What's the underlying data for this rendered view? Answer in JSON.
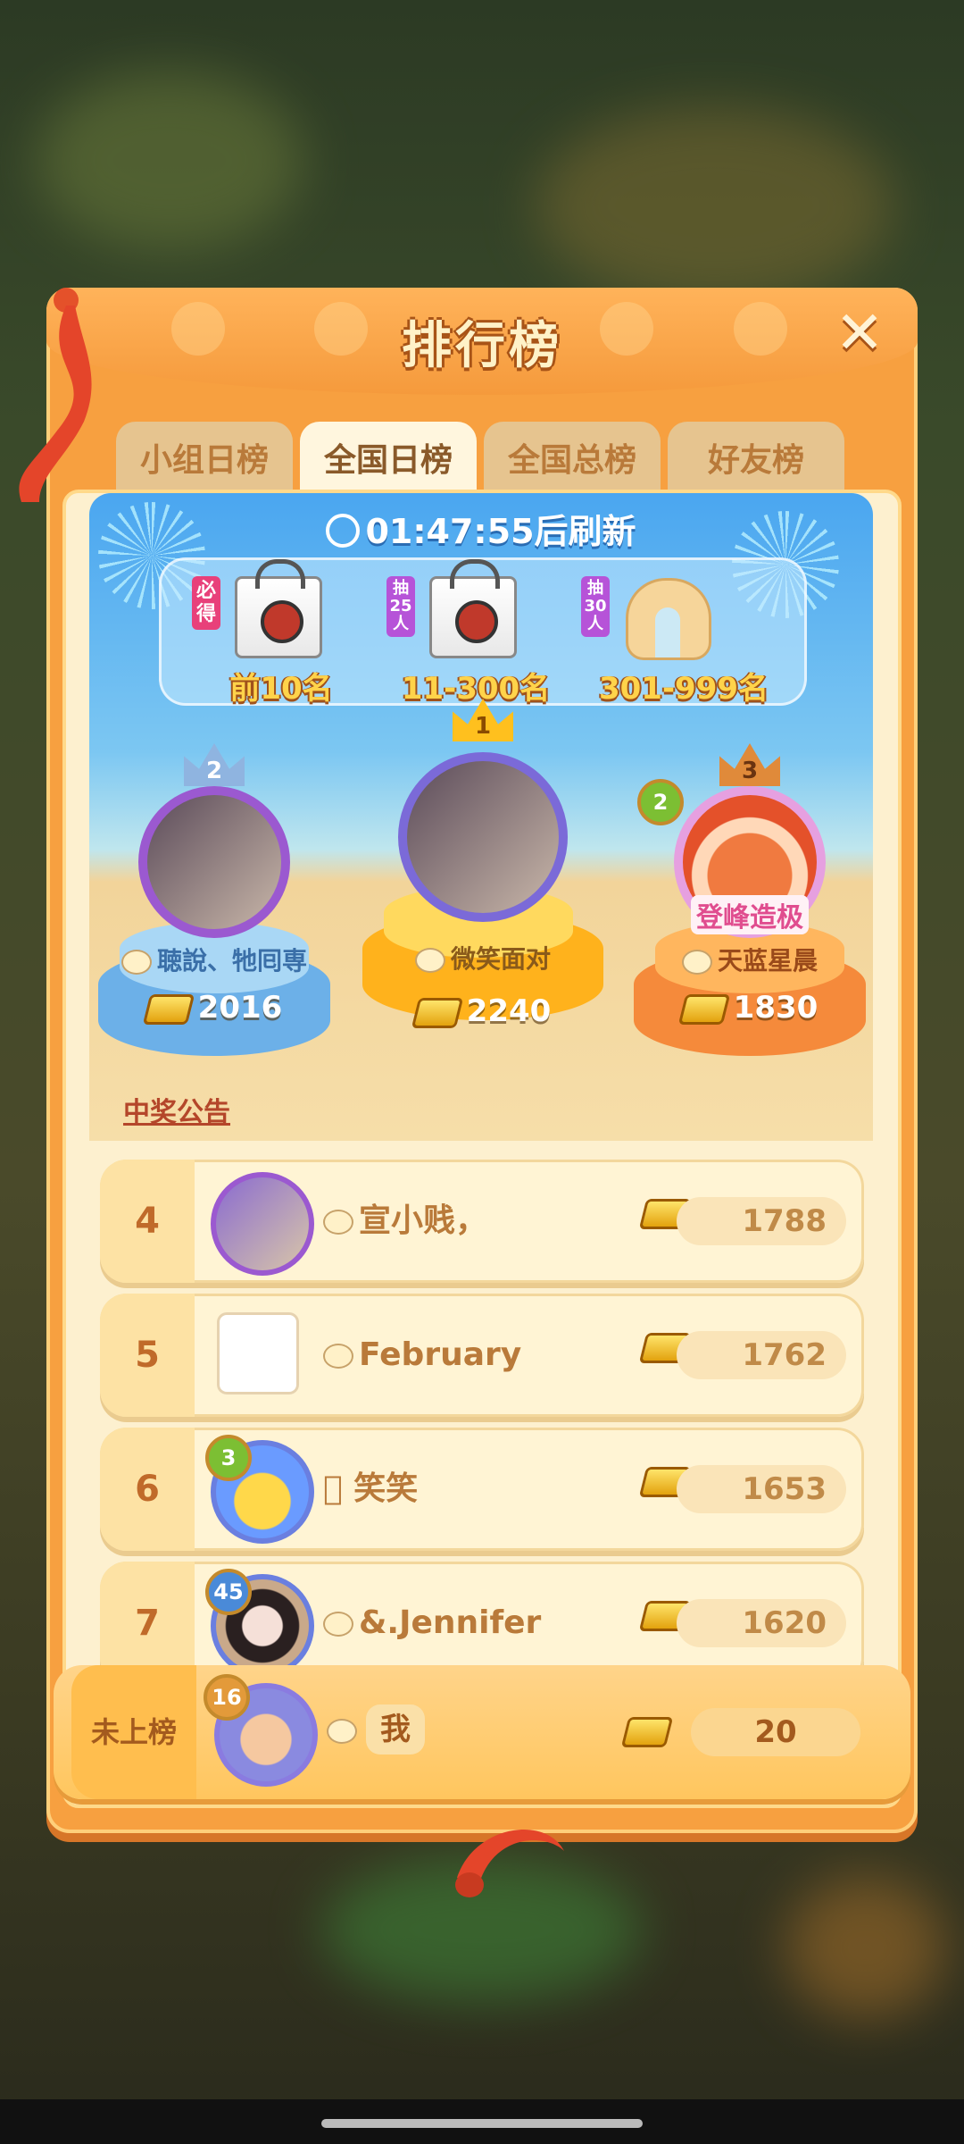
{
  "title": "排行榜",
  "tabs": [
    {
      "label": "小组日榜",
      "active": false
    },
    {
      "label": "全国日榜",
      "active": true
    },
    {
      "label": "全国总榜",
      "active": false
    },
    {
      "label": "好友榜",
      "active": false
    }
  ],
  "timer": {
    "time": "01:47:55",
    "suffix": "后刷新"
  },
  "prizes": [
    {
      "tag": "必得",
      "range": "前10名",
      "item": "bag"
    },
    {
      "tag": "抽25人",
      "range": "11-300名",
      "item": "bag"
    },
    {
      "tag": "抽30人",
      "range": "301-999名",
      "item": "neck-pillow"
    }
  ],
  "podium": [
    {
      "rank": "2",
      "name": "聴說、牠囘専",
      "score": "2016"
    },
    {
      "rank": "1",
      "name": "微笑面对",
      "score": "2240"
    },
    {
      "rank": "3",
      "name": "天蓝星晨",
      "score": "1830",
      "level": "2",
      "avatar_text": "登峰造极"
    }
  ],
  "announcement": "中奖公告",
  "rows": [
    {
      "rank": "4",
      "name": "宣小贱，",
      "score": "1788"
    },
    {
      "rank": "5",
      "name": "February",
      "score": "1762"
    },
    {
      "rank": "6",
      "name": "󾠮 笑笑",
      "score": "1653",
      "level": "3"
    },
    {
      "rank": "7",
      "name": "&.Jennifer",
      "score": "1620",
      "level": "45"
    }
  ],
  "me": {
    "rank": "未上榜",
    "name": "我",
    "score": "20",
    "level": "16"
  },
  "colors": {
    "accent": "#f7a040",
    "panel": "#fdf0cf",
    "sky": "#4aa6f0"
  }
}
